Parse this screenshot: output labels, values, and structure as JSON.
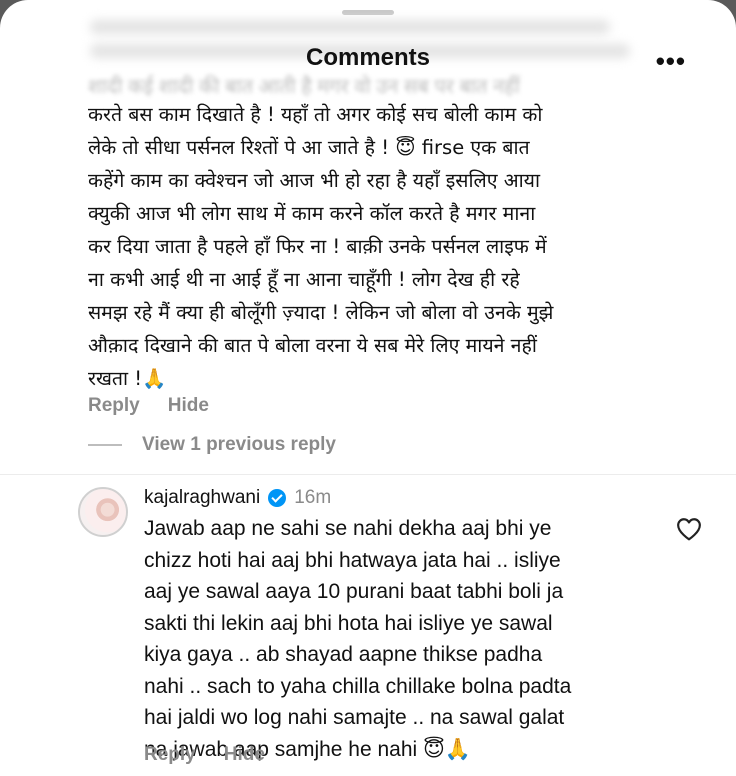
{
  "header": {
    "title": "Comments",
    "more_label": "•••"
  },
  "comment_faded": "शादी कई शादी की बात आती है मगर वो उन सब पर बात नहीं",
  "comment1": {
    "lines": [
      "करते बस काम दिखाते है ! यहाँ तो अगर कोई सच बोली काम को",
      "लेके तो सीधा पर्सनल रिश्तों पे आ जाते है ! 😇 firse एक बात",
      "कहेंगे काम का क्वेश्चन जो आज भी हो रहा है यहाँ इसलिए आया",
      "क्युकी आज भी लोग साथ में काम करने कॉल करते है मगर माना",
      "कर दिया जाता है पहले हाँ फिर ना ! बाक़ी उनके पर्सनल लाइफ में",
      "ना कभी आई थी ना आई हूँ ना आना चाहूँगी ! लोग देख ही रहे",
      "समझ रहे मैं क्या ही बोलूँगी ज़्यादा ! लेकिन जो बोला वो उनके मुझे",
      "औक़ाद दिखाने की बात पे बोला वरना ये सब मेरे लिए मायने नहीं",
      "रखता !🙏"
    ],
    "reply_label": "Reply",
    "hide_label": "Hide"
  },
  "view_previous": "View 1 previous reply",
  "comment2": {
    "username": "kajalraghwani",
    "time": "16m",
    "lines": [
      "Jawab aap ne sahi se nahi dekha aaj bhi ye",
      "chizz hoti hai aaj bhi hatwaya jata hai .. isliye",
      "aaj ye sawal aaya 10 purani baat tabhi boli ja",
      "sakti thi lekin aaj bhi hota hai isliye ye sawal",
      "kiya gaya .. ab shayad aapne thikse padha",
      "nahi .. sach to yaha chilla chillake bolna padta",
      "hai jaldi wo log nahi samajte .. na sawal galat",
      "na jawab aap samjhe he nahi 😇🙏"
    ],
    "reply_label": "Reply",
    "hide_label": "Hide"
  }
}
